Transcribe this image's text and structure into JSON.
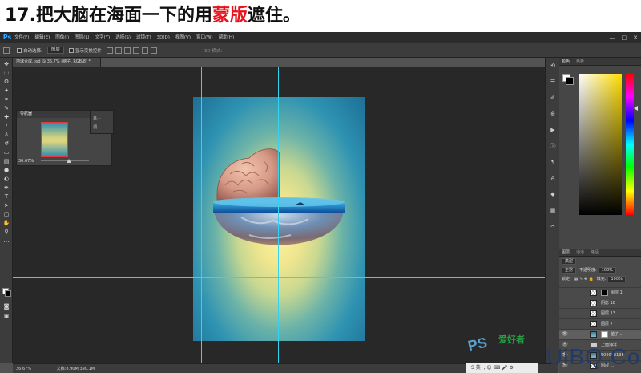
{
  "tutorial": {
    "step_number": "17.",
    "title_part1": "把大脑在海面一下的用",
    "title_highlight": "蒙版",
    "title_part2": "遮住。"
  },
  "menubar": {
    "logo": "Ps",
    "items": [
      "文件(F)",
      "编辑(E)",
      "图像(I)",
      "图层(L)",
      "文字(Y)",
      "选择(S)",
      "滤镜(T)",
      "3D(D)",
      "视图(V)",
      "窗口(W)",
      "帮助(H)"
    ],
    "window_controls": [
      "—",
      "□",
      "✕"
    ]
  },
  "options_bar": {
    "auto_select_label": "自动选择:",
    "auto_select_value": "图层",
    "show_transform_label": "显示变换控件",
    "mode_3d_label": "3D 模式:"
  },
  "document": {
    "tab_title": "地球合成.psd @ 36.7% (脑子, RGB/8) *",
    "status_zoom": "36.67%",
    "status_doc": "文档:8.90M/390.1M"
  },
  "navigator": {
    "tab_label": "导航器",
    "zoom": "36.67%",
    "side_labels": [
      "直...",
      "调..."
    ]
  },
  "color_panel": {
    "tabs": [
      "颜色",
      "色板"
    ],
    "foreground": "#ffffff",
    "background": "#000000",
    "selected_hue": "#ffde00"
  },
  "layers_panel": {
    "tabs": [
      "图层",
      "通道",
      "路径"
    ],
    "filter_label": "类型",
    "blend_mode": "正常",
    "opacity_label": "不透明度:",
    "opacity_value": "100%",
    "lock_label": "锁定:",
    "fill_label": "填充:",
    "fill_value": "100%",
    "layers": [
      {
        "name": "图层 1",
        "thumb": "transparent",
        "mask": "black"
      },
      {
        "name": "阴影 18",
        "thumb": "transparent",
        "mask": "none"
      },
      {
        "name": "图层 13",
        "thumb": "transparent",
        "mask": "none"
      },
      {
        "name": "图层 7",
        "thumb": "transparent",
        "mask": "none"
      },
      {
        "name": "脑子...",
        "thumb": "photo",
        "mask": "white",
        "selected": true
      },
      {
        "name": "上面海洋",
        "thumb": "folder",
        "mask": "none"
      },
      {
        "name": "500058135",
        "thumb": "photo",
        "mask": "none"
      },
      {
        "name": "图层 ...",
        "thumb": "transparent",
        "mask": "none"
      }
    ]
  },
  "watermark": {
    "ps_text": "PS",
    "cn_text": "爱好者",
    "site_text": "UiBQ.CoM"
  },
  "ime": {
    "text": "S 英 ·, ☺ ⌨ 🎤 ⚙"
  },
  "colors": {
    "guide": "#34d4f0",
    "canvas_bg": "#282828",
    "highlight": "#e8121d"
  }
}
